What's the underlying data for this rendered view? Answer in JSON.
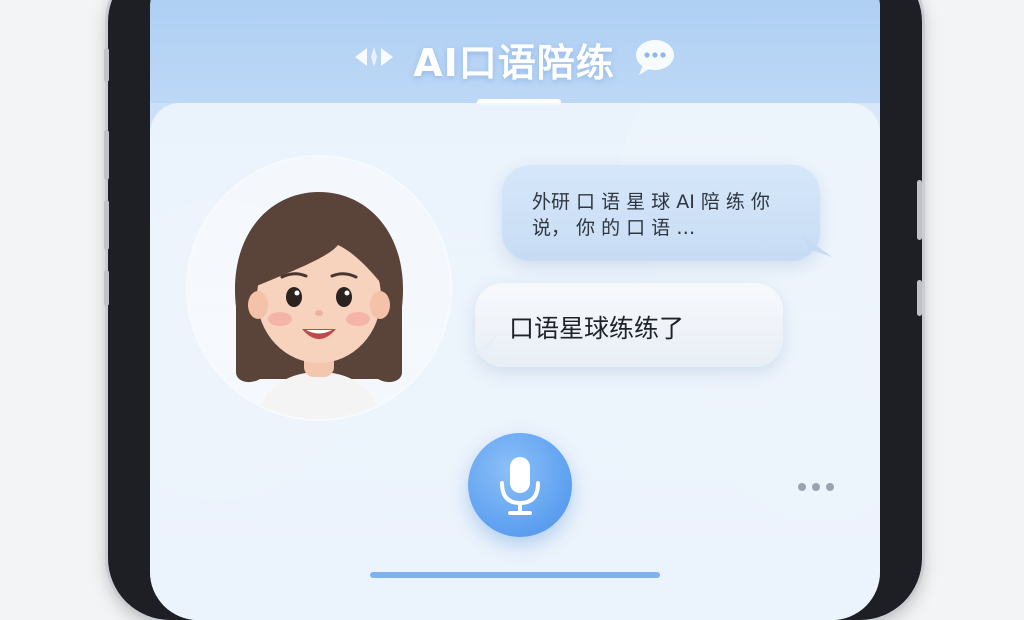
{
  "header": {
    "title": "AI口语陪练",
    "left_icon": "sparkle-arrows-icon",
    "right_icon": "chat-bubble-dots-icon"
  },
  "conversation": {
    "ai_message": "外研 口 语 星 球 AI 陪 练 你 说， 你 的 口 语 …",
    "user_message": "口语星球练练了"
  },
  "controls": {
    "mic_icon": "microphone-icon",
    "more_icon": "more-dots-icon"
  },
  "colors": {
    "accent": "#5c9ff0",
    "header_bg": "#a9ccf2",
    "panel_bg": "#eaf2fb"
  }
}
